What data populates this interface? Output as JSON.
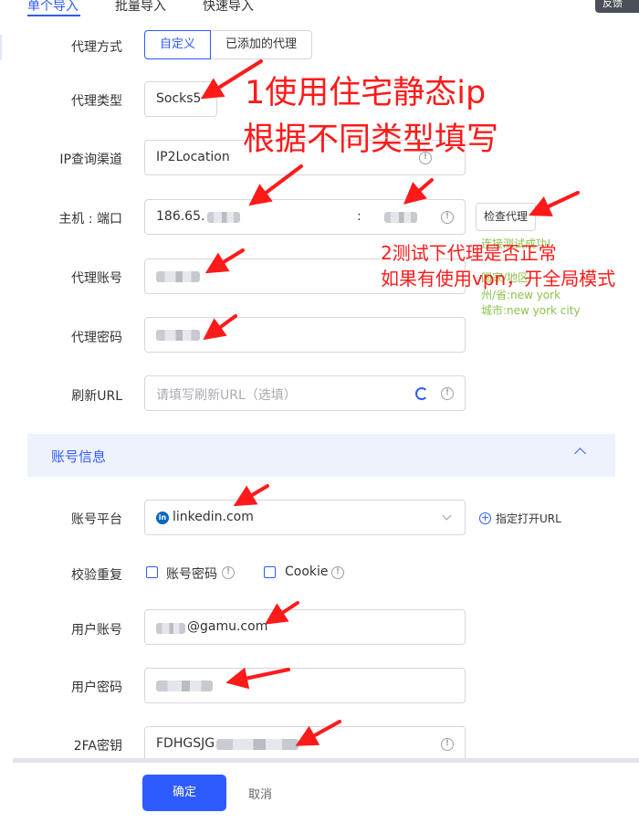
{
  "tabs": [
    "单个导入",
    "批量导入",
    "快速导入"
  ],
  "corner_button": "反馈",
  "proxy": {
    "method_label": "代理方式",
    "method_options": [
      "自定义",
      "已添加的代理"
    ],
    "type_label": "代理类型",
    "type_value": "Socks5",
    "ip_channel_label": "IP查询渠道",
    "ip_channel_value": "IP2Location",
    "host_label": "主机 : 端口",
    "host_value": "186.65.",
    "host_sep": ":",
    "check_button": "检查代理",
    "account_label": "代理账号",
    "password_label": "代理密码",
    "refresh_label": "刷新URL",
    "refresh_placeholder": "请填写刷新URL（选填）",
    "check_result": [
      "连接测试成功!",
      "国家/地区:",
      "州/省:new york",
      "城市:new york city"
    ]
  },
  "account_section": {
    "title": "账号信息",
    "platform_label": "账号平台",
    "platform_value": "linkedin.com",
    "open_url_label": "指定打开URL",
    "dedup_label": "校验重复",
    "dedup_options": [
      "账号密码",
      "Cookie"
    ],
    "user_label": "用户账号",
    "user_value": "@gamu.com",
    "user_password_label": "用户密码",
    "twofa_label": "2FA密钥",
    "twofa_value": "FDHGSJG"
  },
  "footer": {
    "ok": "确定",
    "cancel": "取消"
  },
  "annotations": {
    "note1_line1": "1使用住宅静态ip",
    "note1_line2": "根据不同类型填写",
    "note2_line1": "2测试下代理是否正常",
    "note2_line2": "如果有使用vpn，开全局模式"
  },
  "colors": {
    "accent": "#2e5bff",
    "annotation": "#ff1a1a",
    "success": "#8bc34a"
  }
}
